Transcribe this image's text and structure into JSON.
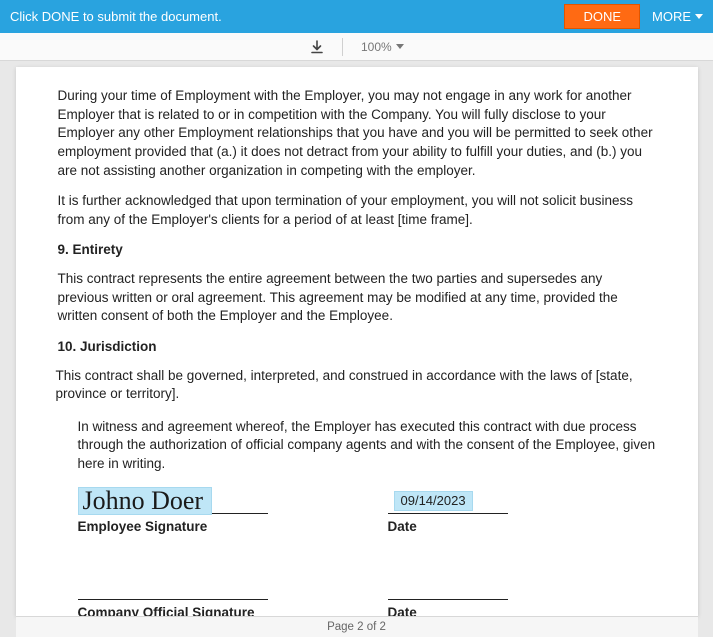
{
  "header": {
    "instruction": "Click DONE to submit the document.",
    "done_label": "DONE",
    "more_label": "MORE"
  },
  "toolbar": {
    "zoom": "100%"
  },
  "doc": {
    "p1": "During your time of Employment with the Employer, you may not engage in any work for another Employer that is related to or in competition with the Company. You will fully disclose to your Employer any other Employment relationships that you have and you will be permitted to seek other employment provided that (a.) it does not detract from your ability to fulfill your duties, and (b.) you are not assisting another organization in competing with the employer.",
    "p2": "It is further acknowledged that upon termination of your employment, you will not solicit business from any of the Employer's clients for a period of at least [time frame].",
    "h9": "9.   Entirety",
    "p3": "This contract represents the entire agreement between the two parties and supersedes any previous written or oral agreement. This agreement may be modified at any time, provided the written consent of both the Employer and the Employee.",
    "h10": "10. Jurisdiction",
    "p4": "This contract shall be governed, interpreted, and construed in accordance with the laws of [state, province or territory].",
    "witness": "In witness and agreement whereof, the Employer has executed this contract with due process through the authorization of official company agents and with the consent of the Employee, given here in writing.",
    "signature_text": "Johno Doer",
    "employee_sig_label": "Employee Signature",
    "date_value": "09/14/2023",
    "date_label": "Date",
    "company_sig_label": "Company Official Signature",
    "date_label2": "Date"
  },
  "footer": {
    "page_indicator": "Page 2 of 2"
  }
}
